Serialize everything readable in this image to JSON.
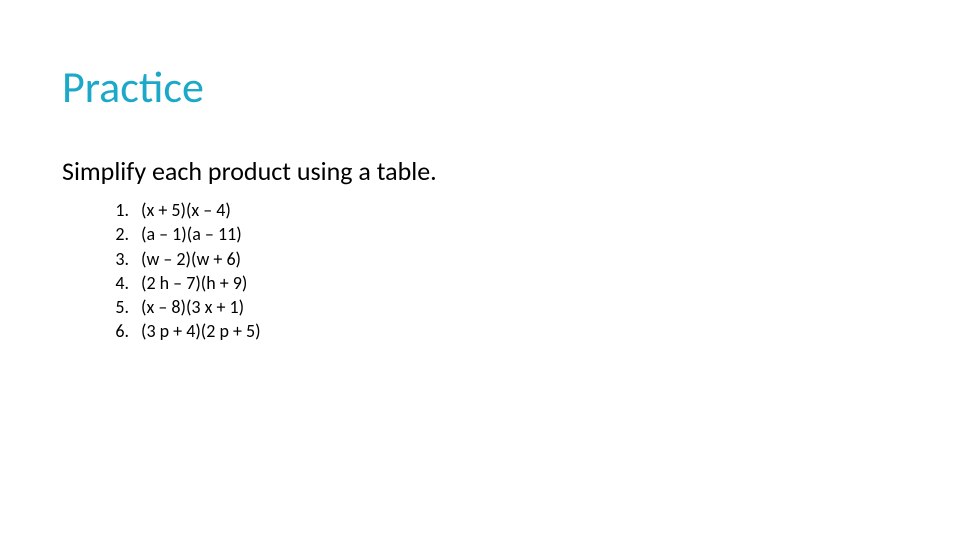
{
  "title": "Practice",
  "instruction": "Simplify each product using a table.",
  "items": [
    {
      "num": "1.",
      "expr": "(x + 5)(x – 4)"
    },
    {
      "num": "2.",
      "expr": "(a – 1)(a – 11)"
    },
    {
      "num": "3.",
      "expr": "(w – 2)(w + 6)"
    },
    {
      "num": "4.",
      "expr": "(2 h – 7)(h + 9)"
    },
    {
      "num": "5.",
      "expr": "(x – 8)(3 x + 1)"
    },
    {
      "num": "6.",
      "expr": "(3 p + 4)(2 p + 5)"
    }
  ]
}
